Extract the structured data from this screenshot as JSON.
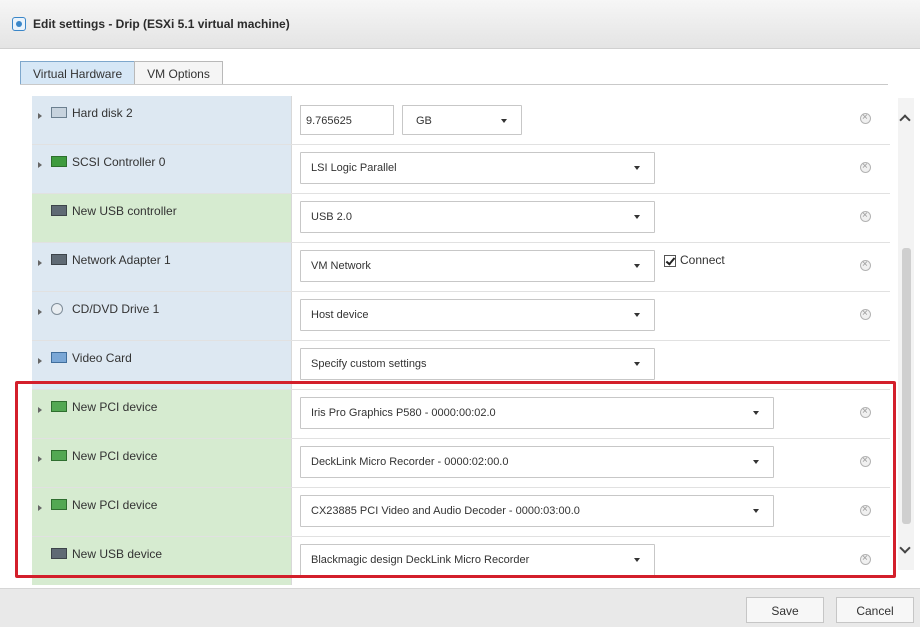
{
  "window": {
    "title": "Edit settings - Drip (ESXi 5.1 virtual machine)",
    "title_icon": "vm-icon"
  },
  "tabs": [
    {
      "label": "Virtual Hardware",
      "active": true
    },
    {
      "label": "VM Options",
      "active": false
    }
  ],
  "hardware_rows": [
    {
      "label": "Hard disk 2",
      "icon": "hard-disk-icon",
      "control": "size",
      "size_value": "9.765625",
      "unit": "GB"
    },
    {
      "label": "SCSI Controller 0",
      "icon": "scsi-controller-icon",
      "control": "select",
      "value": "LSI Logic Parallel"
    },
    {
      "label": "New USB controller",
      "icon": "usb-controller-icon",
      "control": "select",
      "value": "USB 2.0"
    },
    {
      "label": "Network Adapter 1",
      "icon": "network-adapter-icon",
      "control": "select",
      "value": "VM Network",
      "checkbox_label": "Connect",
      "checked": true
    },
    {
      "label": "CD/DVD Drive 1",
      "icon": "cd-dvd-icon",
      "control": "select",
      "value": "Host device"
    },
    {
      "label": "Video Card",
      "icon": "video-card-icon",
      "control": "select",
      "value": "Specify custom settings"
    },
    {
      "label": "New PCI device",
      "icon": "pci-device-icon",
      "control": "select",
      "value": "Iris Pro Graphics P580 - 0000:00:02.0"
    },
    {
      "label": "New PCI device",
      "icon": "pci-device-icon",
      "control": "select",
      "value": "DeckLink Micro Recorder - 0000:02:00.0"
    },
    {
      "label": "New PCI device",
      "icon": "pci-device-icon",
      "control": "select",
      "value": "CX23885 PCI Video and Audio Decoder - 0000:03:00.0"
    },
    {
      "label": "New USB device",
      "icon": "usb-device-icon",
      "control": "select",
      "value": "Blackmagic design DeckLink Micro Recorder"
    }
  ],
  "footer": {
    "save_label": "Save",
    "cancel_label": "Cancel"
  },
  "colors": {
    "highlight": "#d31f2b",
    "tab_active": "#d6e7f6",
    "new_row": "#d6ebd0",
    "existing_row": "#dde8f2"
  }
}
